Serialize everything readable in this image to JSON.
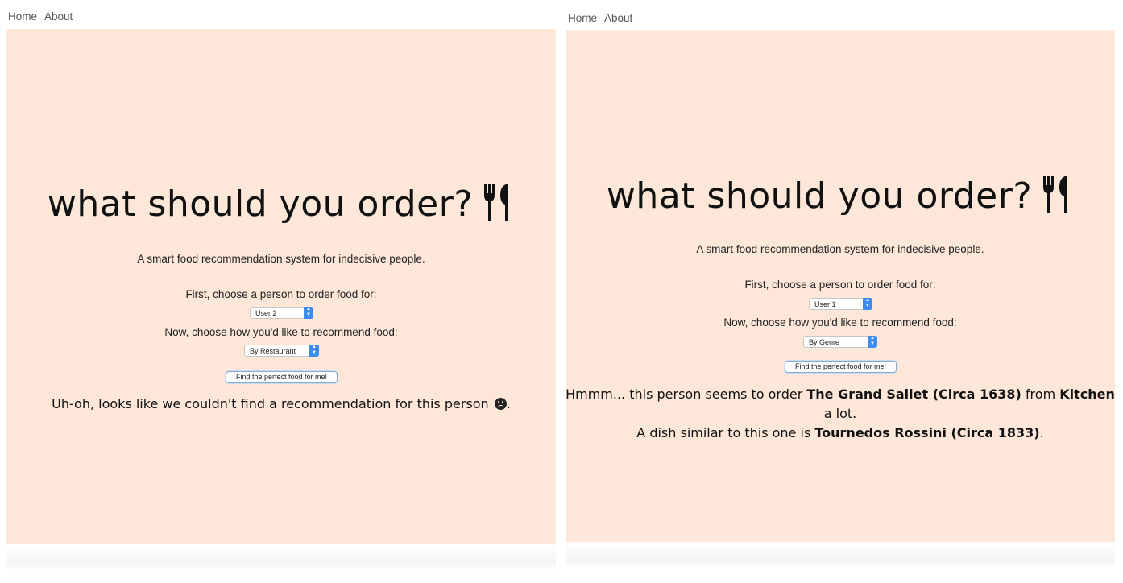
{
  "left": {
    "nav": {
      "home": "Home",
      "about": "About"
    },
    "title": "what should you order?",
    "subtitle": "A smart food recommendation system for indecisive people.",
    "person_prompt": "First, choose a person to order food for:",
    "person_selected": "User 2",
    "method_prompt": "Now, choose how you'd like to recommend food:",
    "method_selected": "By Restaurant",
    "submit_label": "Find the perfect food for me!",
    "result": "Uh-oh, looks like we couldn't find a recommendation for this person",
    "result_end": "."
  },
  "right": {
    "nav": {
      "home": "Home",
      "about": "About"
    },
    "title": "what should you order?",
    "subtitle": "A smart food recommendation system for indecisive people.",
    "person_prompt": "First, choose a person to order food for:",
    "person_selected": "User 1",
    "method_prompt": "Now, choose how you'd like to recommend food:",
    "method_selected": "By Genre",
    "submit_label": "Find the perfect food for me!",
    "result": {
      "part1": "Hmmm... this person seems to order ",
      "dish": "The Grand Sallet (Circa 1638)",
      "part2": " from ",
      "restaurant": "Kitchen",
      "part3": " a lot.",
      "part4": "A dish similar to this one is ",
      "similar_dish": "Tournedos Rossini (Circa 1833)",
      "part5": "."
    }
  },
  "colors": {
    "card_background": "#fde7d8",
    "select_accent": "#3d8cf2"
  },
  "icons": [
    "utensils-icon",
    "sad-face-icon",
    "select-arrows-icon"
  ]
}
